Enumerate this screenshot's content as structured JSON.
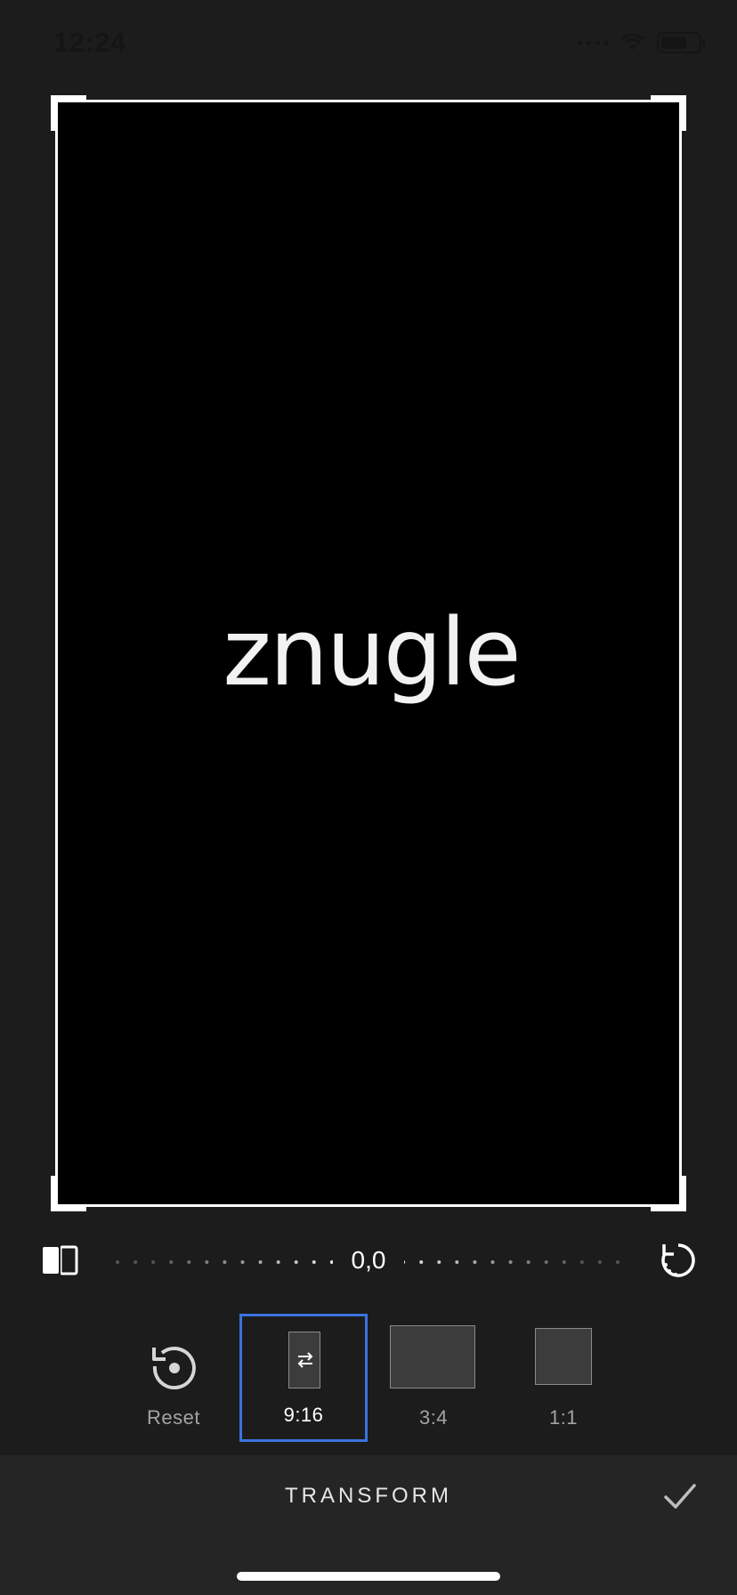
{
  "status_bar": {
    "time": "12:24",
    "icons": [
      "cellular-signal-icon",
      "wifi-icon",
      "battery-icon"
    ]
  },
  "canvas": {
    "background": "#000000",
    "logo_text": "znugle"
  },
  "rotation": {
    "angle_label": "0,0",
    "flip_icon": "flip-horizontal-icon",
    "rotate_icon": "rotate-icon"
  },
  "aspect_options": [
    {
      "label": "Reset",
      "icon": "reset-icon"
    },
    {
      "label": "9:16",
      "selected": true,
      "icon": "swap-orientation-icon"
    },
    {
      "label": "3:4"
    },
    {
      "label": "1:1"
    }
  ],
  "bottom_bar": {
    "title": "TRANSFORM",
    "confirm_icon": "checkmark-icon"
  },
  "colors": {
    "accent": "#3a73e0",
    "background": "#1c1c1c",
    "bottom_bar": "#252525"
  }
}
